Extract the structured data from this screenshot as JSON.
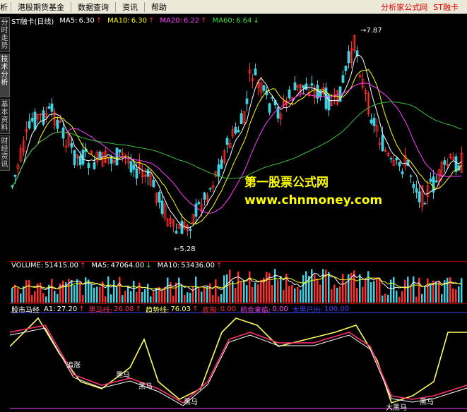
{
  "menubar": {
    "items": [
      "析",
      "港股期货基金",
      "数据查询",
      "资讯",
      "帮助"
    ],
    "brand": "分析家公式网",
    "stock_tag": "ST融卡",
    "brand_color": "#e00000"
  },
  "sidetabs": [
    "分时走势",
    "技术分析",
    "基本资料",
    "财经资讯"
  ],
  "price_panel": {
    "title": "ST融卡(日线)",
    "ma": [
      {
        "label": "MA5:",
        "value": "6.30",
        "arrow": "↑",
        "color": "#ffffff"
      },
      {
        "label": "MA10:",
        "value": "6.30",
        "arrow": "↑",
        "color": "#ffff00"
      },
      {
        "label": "MA20:",
        "value": "6.22",
        "arrow": "↑",
        "color": "#ff40ff"
      },
      {
        "label": "MA60:",
        "value": "6.64",
        "arrow": "↓",
        "color": "#40e040"
      }
    ],
    "high_label": "7.87",
    "low_label": "5.28"
  },
  "watermark": {
    "line1": "第一股票公式网",
    "line2": "www.chnmoney.com",
    "color": "#ffff00"
  },
  "volume_panel": {
    "items": [
      {
        "label": "VOLUME:",
        "value": "51415.00",
        "arrow": "↑",
        "color": "#ffffff"
      },
      {
        "label": "MA5:",
        "value": "47064.00",
        "arrow": "↓",
        "color": "#ffffff"
      },
      {
        "label": "MA10:",
        "value": "53436.00",
        "arrow": "↑",
        "color": "#ffffff"
      }
    ]
  },
  "indicator_panel": {
    "title": "股市马经",
    "items": [
      {
        "label": "A1:",
        "value": "27.20",
        "arrow": "↑",
        "color": "#ffffff"
      },
      {
        "label": "黑马线:",
        "value": "26.08",
        "arrow": "↑",
        "color": "#ff3070"
      },
      {
        "label": "趋势线:",
        "value": "76.03",
        "arrow": "↑",
        "color": "#ffff60"
      },
      {
        "label": "底部:",
        "value": "0.00",
        "arrow": "",
        "color": "#ff3030"
      },
      {
        "label": "机会来临:",
        "value": "0.00",
        "arrow": "",
        "color": "#ff40ff"
      },
      {
        "label": "大黑已出:",
        "value": "100.00",
        "arrow": "",
        "color": "#4040ff"
      }
    ],
    "annotations": [
      "追涨",
      "黑马",
      "黑马",
      "黑马",
      "大黑马",
      "黑马"
    ]
  },
  "colors": {
    "up_candle": "#ff3030",
    "down_candle": "#40d0e0",
    "ma5": "#ffffff",
    "ma10": "#ffff00",
    "ma20": "#ff40ff",
    "ma60": "#40c040"
  }
}
